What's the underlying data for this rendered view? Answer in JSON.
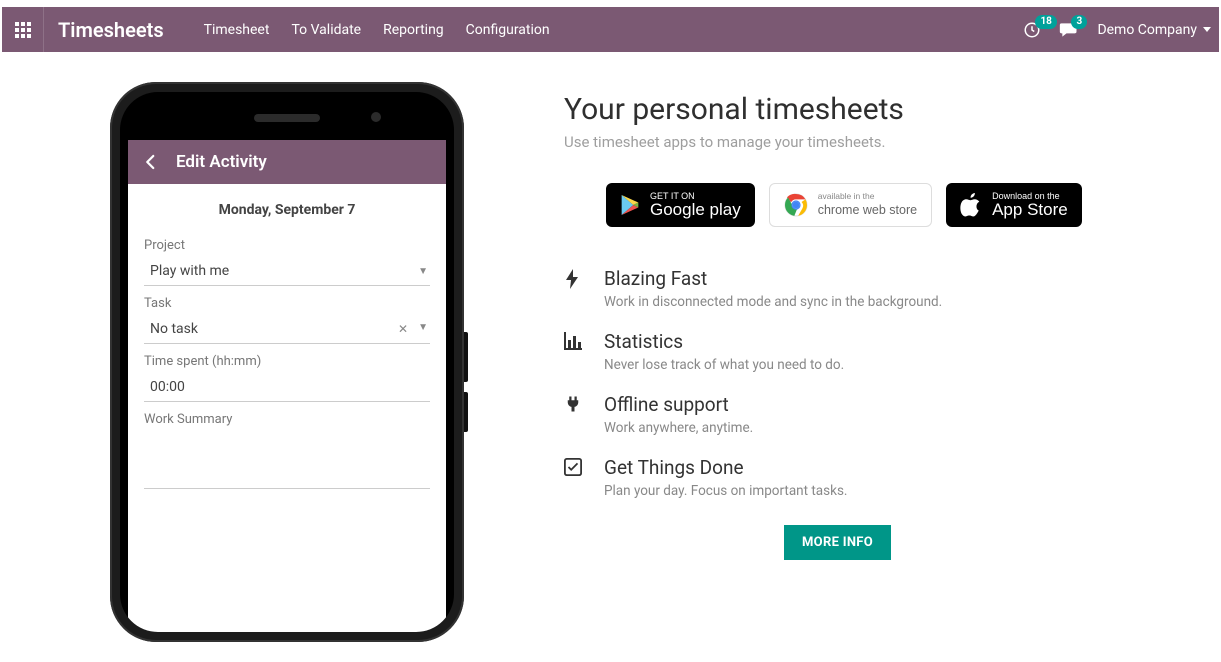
{
  "navbar": {
    "brand": "Timesheets",
    "links": [
      "Timesheet",
      "To Validate",
      "Reporting",
      "Configuration"
    ],
    "activities_badge": "18",
    "messages_badge": "3",
    "company": "Demo Company"
  },
  "phone": {
    "header_title": "Edit Activity",
    "date": "Monday, September 7",
    "labels": {
      "project": "Project",
      "task": "Task",
      "time_spent": "Time spent (hh:mm)",
      "work_summary": "Work Summary"
    },
    "values": {
      "project": "Play with me",
      "task": "No task",
      "time_spent": "00:00"
    }
  },
  "promo": {
    "title": "Your personal timesheets",
    "subtitle": "Use timesheet apps to manage your timesheets.",
    "stores": {
      "google_small": "GET IT ON",
      "google_big": "Google play",
      "chrome_small": "available in the",
      "chrome_big": "chrome web store",
      "apple_small": "Download on the",
      "apple_big": "App Store"
    },
    "features": [
      {
        "icon": "bolt",
        "title": "Blazing Fast",
        "desc": "Work in disconnected mode and sync in the background."
      },
      {
        "icon": "stats",
        "title": "Statistics",
        "desc": "Never lose track of what you need to do."
      },
      {
        "icon": "plug",
        "title": "Offline support",
        "desc": "Work anywhere, anytime."
      },
      {
        "icon": "check",
        "title": "Get Things Done",
        "desc": "Plan your day. Focus on important tasks."
      }
    ],
    "more_info": "MORE INFO"
  }
}
